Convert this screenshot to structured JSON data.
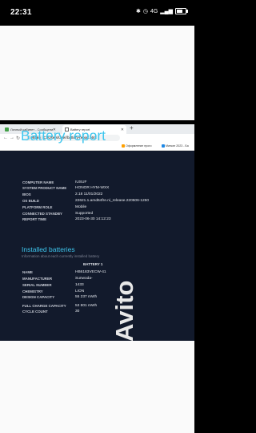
{
  "status_bar": {
    "time": "22:31",
    "network": "4G",
    "battery_level_percent": 66,
    "bluetooth_icon": "bluetooth-icon",
    "alarm_icon": "alarm-icon"
  },
  "browser": {
    "tabs": [
      {
        "label": "Личный кабинет - Сообщени",
        "active": false
      },
      {
        "label": "Battery report",
        "active": true
      }
    ],
    "new_tab": "+",
    "address_prefix": "Файл",
    "address_path": "C:/Users/User/battery-report.html",
    "bookmarks": [
      "Оформление прого",
      "Минкат 2023 - Ба"
    ]
  },
  "report": {
    "title": "Battery report",
    "system": [
      {
        "label": "COMPUTER NAME",
        "value": "IUSUF"
      },
      {
        "label": "SYSTEM PRODUCT NAME",
        "value": "HONOR HYM-WXX"
      },
      {
        "label": "BIOS",
        "value": "2.18 11/01/2022"
      },
      {
        "label": "OS BUILD",
        "value": "22621.1.amd64fre.ni_release.220506-1250"
      },
      {
        "label": "PLATFORM ROLE",
        "value": "Mobile"
      },
      {
        "label": "CONNECTED STANDBY",
        "value": "Supported"
      },
      {
        "label": "REPORT TIME",
        "value": "2023-06-30  14:12:23"
      }
    ],
    "installed_batteries": {
      "title": "Installed batteries",
      "subtitle": "Information about each currently installed battery",
      "column": "BATTERY 1",
      "rows": [
        {
          "label": "NAME",
          "value": "HB6183VECW-41"
        },
        {
          "label": "MANUFACTURER",
          "value": "Sunwoda-"
        },
        {
          "label": "SERIAL NUMBER",
          "value": "1433"
        },
        {
          "label": "CHEMISTRY",
          "value": "LION"
        },
        {
          "label": "DESIGN CAPACITY",
          "value": "55 237 mWh"
        },
        {
          "label": "FULL CHARGE CAPACITY",
          "value": "53 801 mWh"
        },
        {
          "label": "CYCLE COUNT",
          "value": "30"
        }
      ]
    }
  },
  "colors": {
    "accent": "#3ec6ee",
    "report_bg": "#121a2c",
    "tab_bar": "#e9ecef"
  }
}
